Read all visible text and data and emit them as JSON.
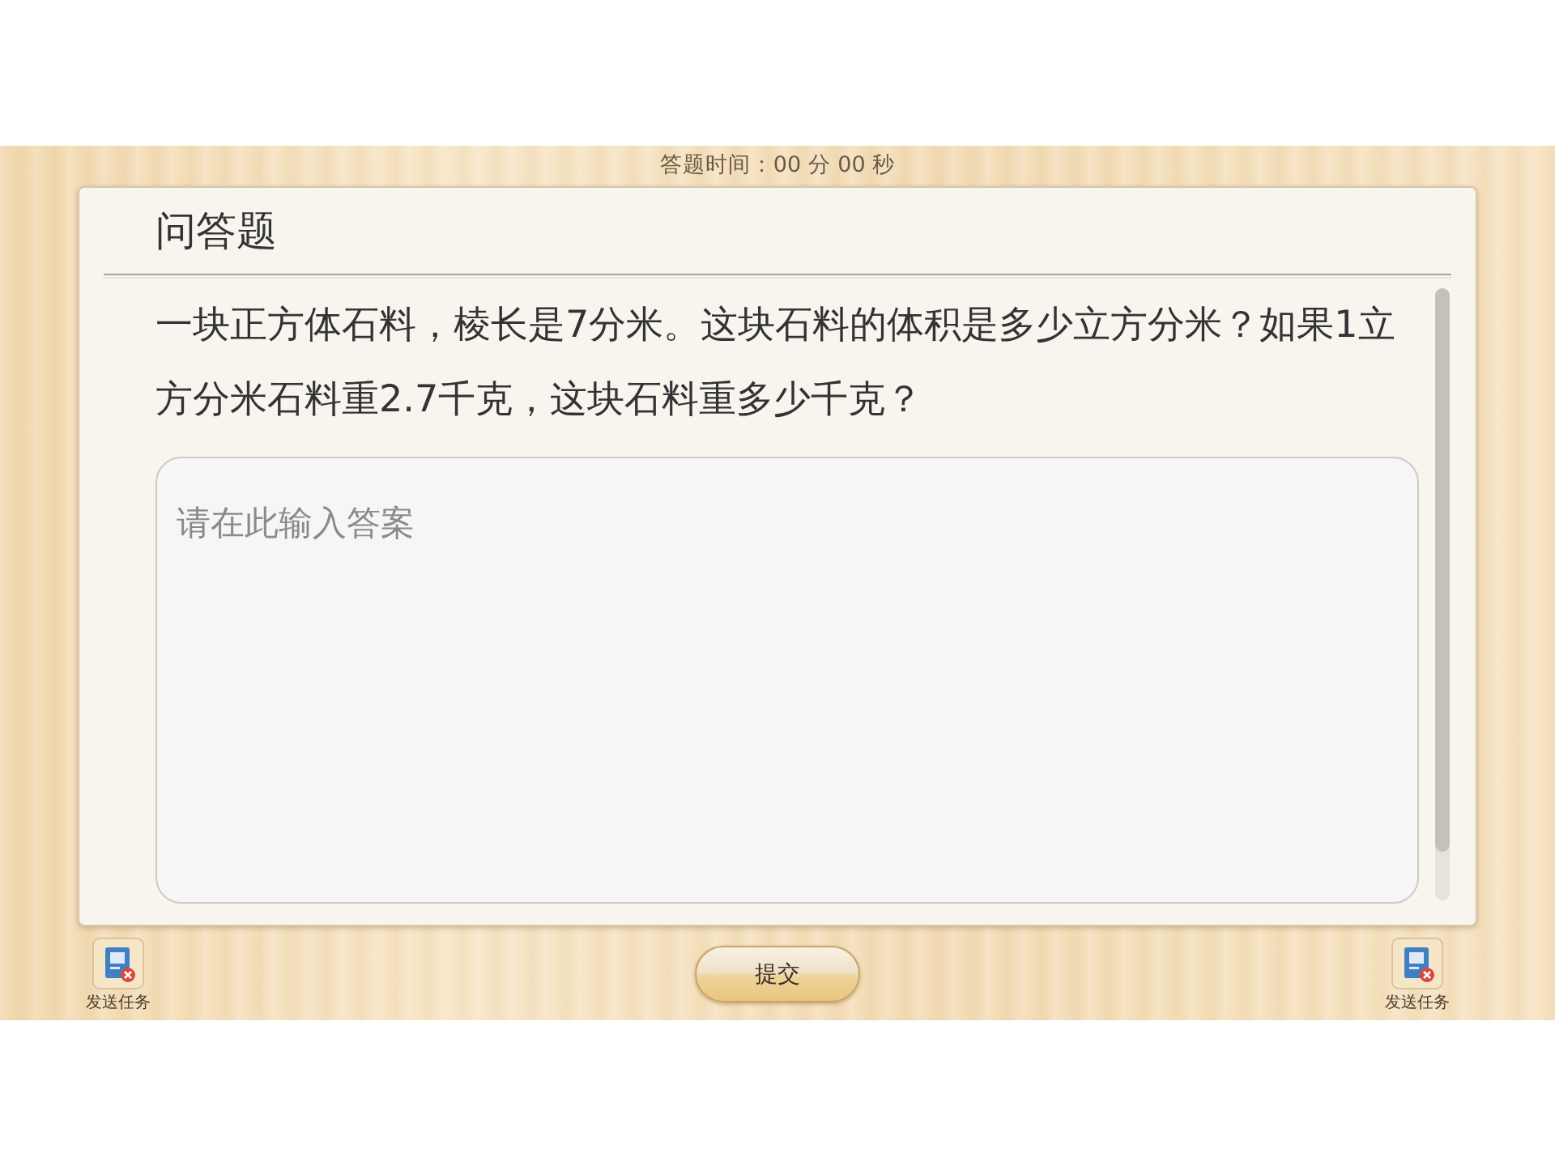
{
  "timer": {
    "text": "答题时间：00 分 00 秒"
  },
  "question": {
    "type_title": "问答题",
    "text": "一块正方体石料，棱长是7分米。这块石料的体积是多少立方分米？如果1立方分米石料重2.7千克，这块石料重多少千克？",
    "answer": {
      "placeholder": "请在此输入答案"
    }
  },
  "submit_button": {
    "label": "提交"
  },
  "footer_buttons": [
    {
      "label": "发送任务"
    },
    {
      "label": "发送任务"
    }
  ]
}
